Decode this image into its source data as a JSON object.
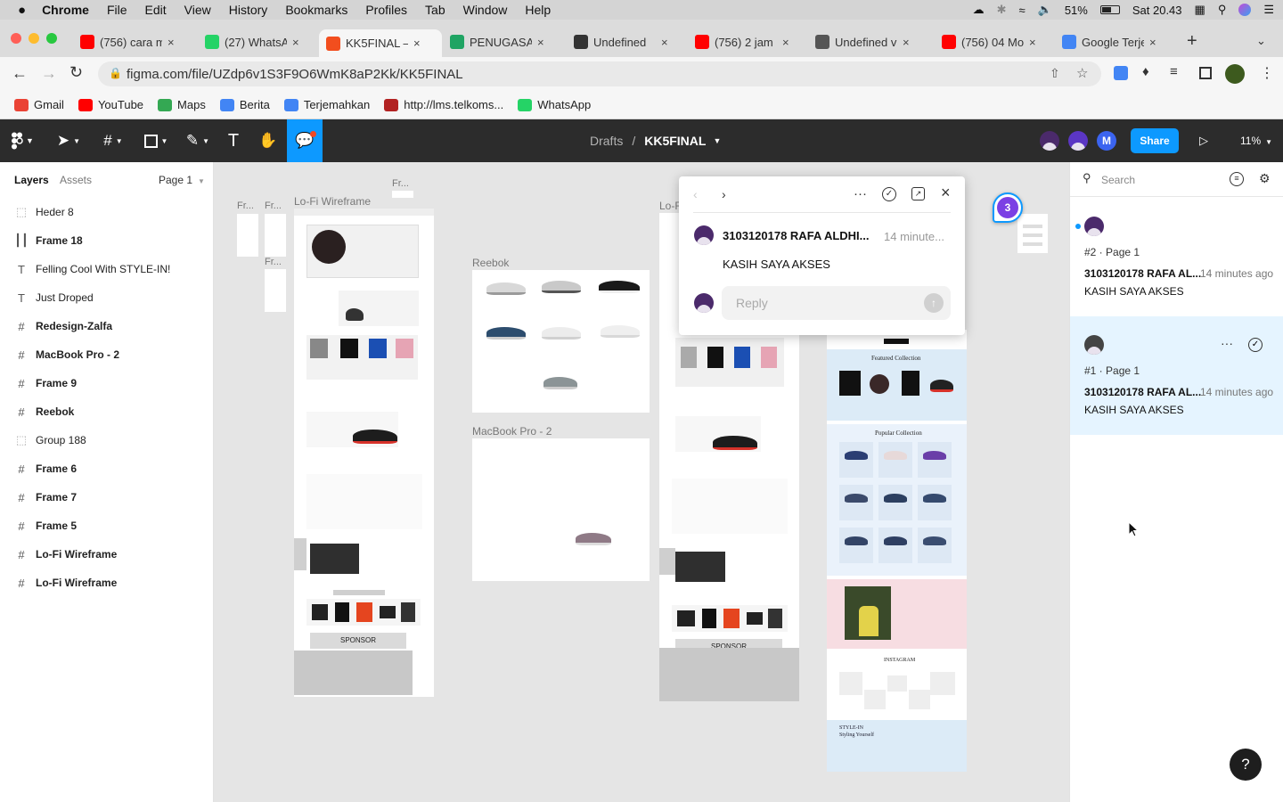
{
  "menubar": {
    "apple": "",
    "app": "Chrome",
    "items": [
      "File",
      "Edit",
      "View",
      "History",
      "Bookmarks",
      "Profiles",
      "Tab",
      "Window",
      "Help"
    ],
    "battery": "51%",
    "clock": "Sat 20.43"
  },
  "tabs": [
    {
      "title": "(756) cara m",
      "icon": "youtube-icon",
      "color": "#ff0000"
    },
    {
      "title": "(27) WhatsAp",
      "icon": "whatsapp-icon",
      "color": "#25d366"
    },
    {
      "title": "KK5FINAL – F",
      "icon": "figma-icon",
      "color": "#f24e1e"
    },
    {
      "title": "PENUGASAN",
      "icon": "drive-icon",
      "color": "#1fa463"
    },
    {
      "title": "Undefined",
      "icon": "globe-icon",
      "color": "#333333"
    },
    {
      "title": "(756) 2 jam b",
      "icon": "youtube-icon",
      "color": "#ff0000"
    },
    {
      "title": "Undefined va",
      "icon": "send-icon",
      "color": "#555555"
    },
    {
      "title": "(756) 04 Mo",
      "icon": "youtube-icon",
      "color": "#ff0000"
    },
    {
      "title": "Google Terje",
      "icon": "translate-icon",
      "color": "#4285f4"
    }
  ],
  "address": {
    "url": "figma.com/file/UZdp6v1S3F9O6WmK8aP2Kk/KK5FINAL"
  },
  "bookmarks": [
    {
      "label": "Gmail",
      "color": "#ea4335"
    },
    {
      "label": "YouTube",
      "color": "#ff0000"
    },
    {
      "label": "Maps",
      "color": "#34a853"
    },
    {
      "label": "Berita",
      "color": "#4285f4"
    },
    {
      "label": "Terjemahkan",
      "color": "#4285f4"
    },
    {
      "label": "http://lms.telkoms...",
      "color": "#b22222"
    },
    {
      "label": "WhatsApp",
      "color": "#25d366"
    }
  ],
  "figma": {
    "breadcrumb_drafts": "Drafts",
    "breadcrumb_sep": "/",
    "file_name": "KK5FINAL",
    "share": "Share",
    "zoom": "11%",
    "avatar_m": "M",
    "accent": "#0d99ff"
  },
  "left_panel": {
    "tab_layers": "Layers",
    "tab_assets": "Assets",
    "page": "Page 1",
    "layers": [
      {
        "name": "Heder 8",
        "icon": "group-icon"
      },
      {
        "name": "Frame 18",
        "icon": "columns-icon"
      },
      {
        "name": "Felling Cool With STYLE-IN!",
        "icon": "text-icon"
      },
      {
        "name": "Just Droped",
        "icon": "text-icon"
      },
      {
        "name": "Redesign-Zalfa",
        "icon": "frame-icon"
      },
      {
        "name": "MacBook Pro - 2",
        "icon": "frame-icon"
      },
      {
        "name": "Frame 9",
        "icon": "frame-icon"
      },
      {
        "name": "Reebok",
        "icon": "frame-icon"
      },
      {
        "name": "Group 188",
        "icon": "group-icon"
      },
      {
        "name": "Frame 6",
        "icon": "frame-icon"
      },
      {
        "name": "Frame 7",
        "icon": "frame-icon"
      },
      {
        "name": "Frame 5",
        "icon": "frame-icon"
      },
      {
        "name": "Lo-Fi Wireframe",
        "icon": "frame-icon"
      },
      {
        "name": "Lo-Fi Wireframe",
        "icon": "frame-icon"
      }
    ]
  },
  "canvas": {
    "frame_labels": {
      "lofi1": "Lo-Fi Wireframe",
      "reebok": "Reebok",
      "macbook": "MacBook Pro - 2",
      "lofi2": "Lo-F",
      "fr1": "Fr...",
      "fr2": "Fr...",
      "fr3": "Fr...",
      "fr4": "Fr..."
    },
    "comment_pin_count": "3",
    "wire_text": {
      "sponsor1": "SPONSOR",
      "sponsor2": "SPONSOR",
      "featured": "Featured Collection",
      "popular": "Popular Collection",
      "instagram": "INSTAGRAM",
      "stylein": "STYLE-IN",
      "stylein_sub": "Styling Yourself"
    }
  },
  "comment_popup": {
    "author": "3103120178 RAFA ALDHI...",
    "time": "14 minute...",
    "body": "KASIH SAYA AKSES",
    "reply_placeholder": "Reply"
  },
  "right_panel": {
    "search_placeholder": "Search",
    "comments": [
      {
        "meta": "#2 · Page 1",
        "author": "3103120178 RAFA AL...",
        "time": "14 minutes ago",
        "body": "KASIH SAYA AKSES",
        "unread": true,
        "selected": false
      },
      {
        "meta": "#1 · Page 1",
        "author": "3103120178 RAFA AL...",
        "time": "14 minutes ago",
        "body": "KASIH SAYA AKSES",
        "unread": false,
        "selected": true
      }
    ]
  },
  "help": "?"
}
